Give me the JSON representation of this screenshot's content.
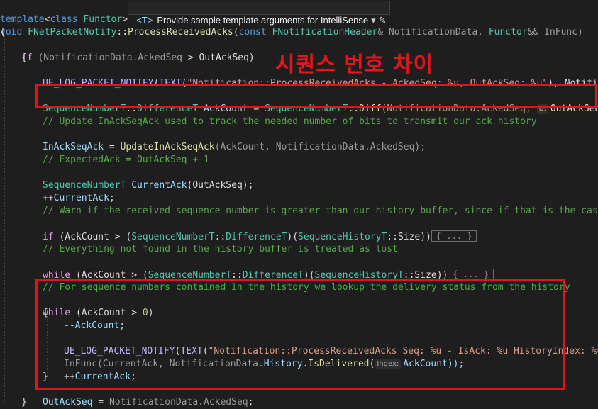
{
  "intellisense": {
    "badge": "<T>",
    "text": "Provide sample template arguments for IntelliSense",
    "caret": "▾",
    "pencil": "✎"
  },
  "annotation": {
    "text": "시퀀스 번호 차이"
  },
  "code": {
    "l1": {
      "a": "template",
      "b": "<",
      "c": "class",
      "d": " Functor",
      "e": ">"
    },
    "l2": {
      "a": "void ",
      "b": "FNetPacketNotify",
      "c": "::",
      "d": "ProcessReceivedAcks",
      "e": "(",
      "f": "const ",
      "g": "FNotificationHeader",
      "h": "& NotificationData, ",
      "i": "Functor",
      "j": "&& InFunc)"
    },
    "l3": {
      "a": "{"
    },
    "l4": {
      "a": "if",
      "b": " (NotificationData.",
      "c": "AckedSeq",
      "d": " > OutAckSeq)"
    },
    "l5": {
      "a": "{"
    },
    "l6": {
      "a": "UE_LOG_PACKET_NOTIFY",
      "b": "(",
      "c": "TEXT",
      "d": "(",
      "e": "\"Notification::ProcessReceivedAcks - AckedSeq: %u, OutAckSeq: %u\"",
      "f": "), Notificati"
    },
    "l7": {
      "a": "SequenceNumberT",
      "b": "::",
      "c": "DifferenceT",
      "d": " AckCount",
      "e": " = ",
      "f": "SequenceNumberT",
      "g": "::",
      "h": "Diff",
      "i": "(NotificationData.AckedSeq, ",
      "hint": "B:",
      "j": "OutAckSeq);"
    },
    "l8": {
      "a": "// Update InAckSeqAck used to track the needed number of bits to transmit our ack history"
    },
    "l9": {
      "a": "InAckSeqAck",
      "b": " = ",
      "c": "UpdateInAckSeqAck",
      "d": "(AckCount, NotificationData.AckedSeq);"
    },
    "l10": {
      "a": "// ExpectedAck = OutAckSeq + 1"
    },
    "l11": {
      "a": "SequenceNumberT",
      "b": " CurrentAck",
      "c": "(OutAckSeq);"
    },
    "l12": {
      "a": "++",
      "b": "CurrentAck",
      "c": ";"
    },
    "l13": {
      "a": "// Warn if the received sequence number is greater than our history buffer, since if that is the case we"
    },
    "l14": {
      "a": "if",
      "b": " (AckCount > (",
      "c": "SequenceNumberT",
      "d": "::",
      "e": "DifferenceT",
      "f": ")(",
      "g": "SequenceHistoryT",
      "h": "::",
      "i": "Size",
      "j": "))",
      "fold": "{ ... }"
    },
    "l15": {
      "a": "// Everything not found in the history buffer is treated as lost"
    },
    "l16": {
      "a": "while",
      "b": " (AckCount > (",
      "c": "SequenceNumberT",
      "d": "::",
      "e": "DifferenceT",
      "f": ")(",
      "g": "SequenceHistoryT",
      "h": "::",
      "i": "Size",
      "j": "))",
      "fold": "{ ... }"
    },
    "l17": {
      "a": "// For sequence numbers contained in the history we lookup the delivery status from the history"
    },
    "l18": {
      "a": "while",
      "b": " (AckCount > ",
      "c": "0",
      "d": ")"
    },
    "l19": {
      "a": "{"
    },
    "l20": {
      "a": "--AckCount;"
    },
    "l21": {
      "a": "UE_LOG_PACKET_NOTIFY",
      "b": "(",
      "c": "TEXT",
      "d": "(",
      "e": "\"Notification::ProcessReceivedAcks Seq: %u - IsAck: %u HistoryIndex: %u\"",
      "f": "), "
    },
    "l22": {
      "a": "InFunc",
      "b": "(CurrentAck, NotificationData.",
      "c": "History",
      "d": ".",
      "e": "IsDelivered",
      "f": "(",
      "hint": "Index:",
      "g": "AckCount));"
    },
    "l23": {
      "a": "++",
      "b": "CurrentAck",
      "c": ";"
    },
    "l24": {
      "a": "}"
    },
    "l25": {
      "a": "OutAckSeq",
      "b": " = ",
      "c": "NotificationData.",
      "d": "AckedSeq",
      "e": ";"
    },
    "l26": {
      "a": "}"
    }
  }
}
